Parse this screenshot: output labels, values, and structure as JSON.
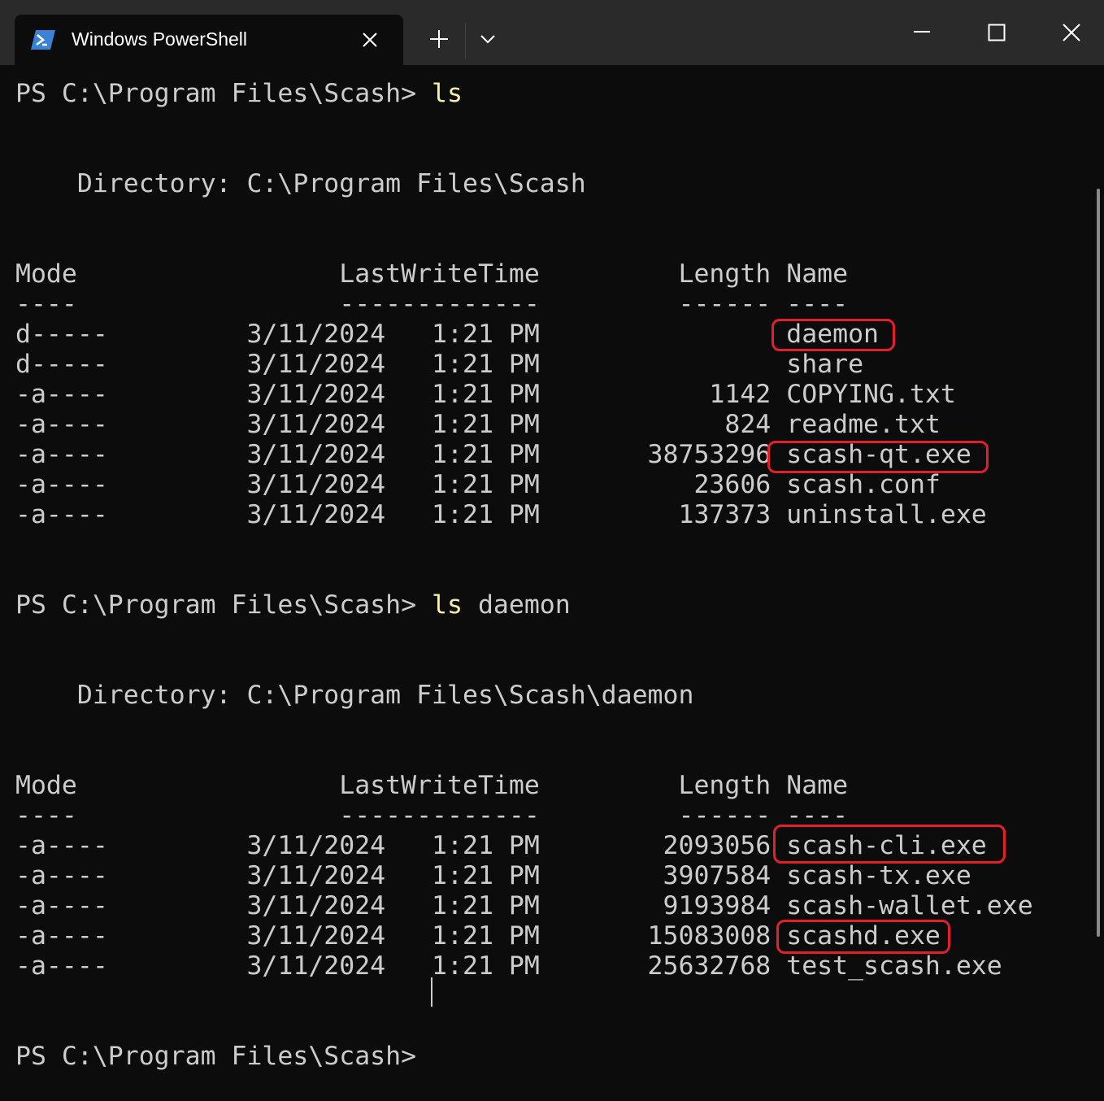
{
  "window": {
    "tab_title": "Windows PowerShell",
    "icons": {
      "tab": "powershell-icon",
      "tab_close": "close-icon",
      "new_tab": "plus-icon",
      "dropdown": "chevron-down-icon",
      "minimize": "minimize-icon",
      "maximize": "maximize-icon",
      "close": "close-icon"
    }
  },
  "colors": {
    "background": "#0c0c0c",
    "text": "#cccccc",
    "command": "#f9f1a5",
    "highlight": "#e3202a"
  },
  "terminal": {
    "lines": [
      {
        "prompt": "PS C:\\Program Files\\Scash> ",
        "cmd": "ls",
        "arg": ""
      },
      {
        "text": ""
      },
      {
        "text": ""
      },
      {
        "text": "    Directory: C:\\Program Files\\Scash"
      },
      {
        "text": ""
      },
      {
        "text": ""
      },
      {
        "text": "Mode                 LastWriteTime         Length Name"
      },
      {
        "text": "----                 -------------         ------ ----"
      },
      {
        "text": "d-----         3/11/2024   1:21 PM                daemon"
      },
      {
        "text": "d-----         3/11/2024   1:21 PM                share"
      },
      {
        "text": "-a----         3/11/2024   1:21 PM           1142 COPYING.txt"
      },
      {
        "text": "-a----         3/11/2024   1:21 PM            824 readme.txt"
      },
      {
        "text": "-a----         3/11/2024   1:21 PM       38753296 scash-qt.exe"
      },
      {
        "text": "-a----         3/11/2024   1:21 PM          23606 scash.conf"
      },
      {
        "text": "-a----         3/11/2024   1:21 PM         137373 uninstall.exe"
      },
      {
        "text": ""
      },
      {
        "text": ""
      },
      {
        "prompt": "PS C:\\Program Files\\Scash> ",
        "cmd": "ls",
        "arg": " daemon"
      },
      {
        "text": ""
      },
      {
        "text": ""
      },
      {
        "text": "    Directory: C:\\Program Files\\Scash\\daemon"
      },
      {
        "text": ""
      },
      {
        "text": ""
      },
      {
        "text": "Mode                 LastWriteTime         Length Name"
      },
      {
        "text": "----                 -------------         ------ ----"
      },
      {
        "text": "-a----         3/11/2024   1:21 PM        2093056 scash-cli.exe"
      },
      {
        "text": "-a----         3/11/2024   1:21 PM        3907584 scash-tx.exe"
      },
      {
        "text": "-a----         3/11/2024   1:21 PM        9193984 scash-wallet.exe"
      },
      {
        "text": "-a----         3/11/2024   1:21 PM       15083008 scashd.exe"
      },
      {
        "text": "-a----         3/11/2024   1:21 PM       25632768 test_scash.exe"
      },
      {
        "text": ""
      },
      {
        "text": ""
      },
      {
        "prompt": "PS C:\\Program Files\\Scash> ",
        "cmd": "",
        "arg": ""
      }
    ]
  }
}
